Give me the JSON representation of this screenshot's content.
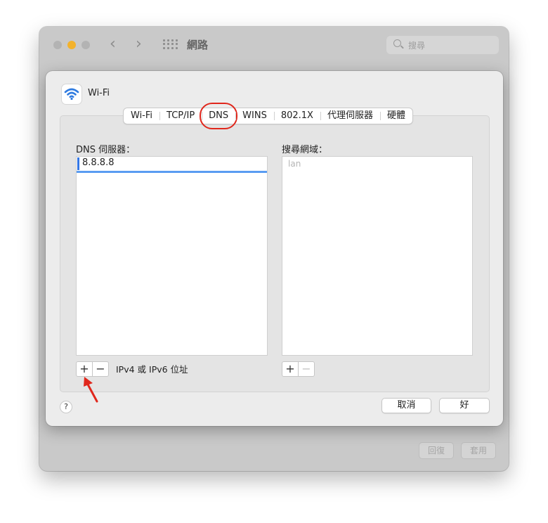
{
  "window": {
    "title": "網路",
    "search_placeholder": "搜尋",
    "revert_label": "回復",
    "apply_label": "套用"
  },
  "sheet": {
    "interface_name": "Wi-Fi",
    "tabs": [
      "Wi-Fi",
      "TCP/IP",
      "DNS",
      "WINS",
      "802.1X",
      "代理伺服器",
      "硬體"
    ],
    "active_tab": "DNS",
    "dns_servers_label": "DNS 伺服器：",
    "dns_servers": [
      "8.8.8.8"
    ],
    "search_domains_label": "搜尋網域：",
    "search_domains_placeholder": "lan",
    "add_label": "+",
    "remove_label": "−",
    "address_hint": "IPv4 或 IPv6 位址",
    "help_label": "?",
    "cancel_label": "取消",
    "ok_label": "好"
  },
  "colors": {
    "accent": "#3477e5",
    "highlight_annotation": "#e0271c",
    "traffic_minimize": "#f3b22c"
  }
}
